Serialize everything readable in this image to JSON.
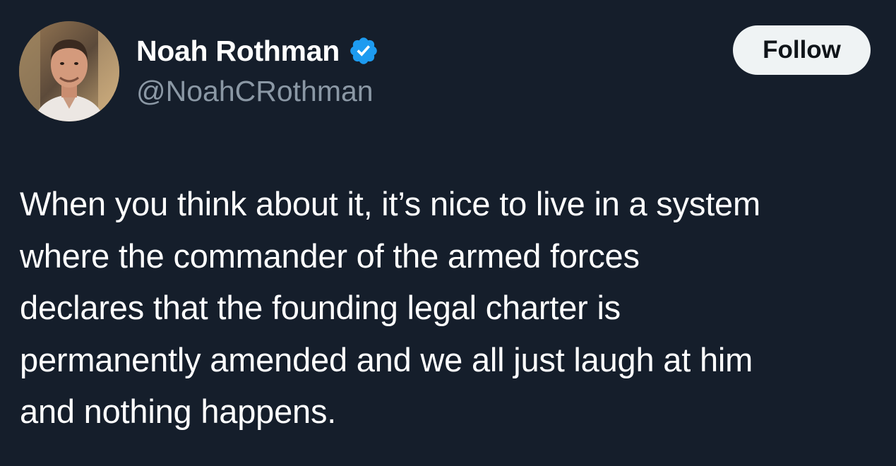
{
  "author": {
    "display_name": "Noah Rothman",
    "handle": "@NoahCRothman",
    "verified": true,
    "avatar_icon": "profile-photo"
  },
  "actions": {
    "follow_label": "Follow"
  },
  "tweet": {
    "lines": [
      "When you think about it, it’s nice to live in a system",
      "where the commander of the armed forces",
      "declares that the founding legal charter is",
      "permanently amended and we all just laugh at him",
      "and nothing happens."
    ]
  },
  "colors": {
    "background": "#151e2b",
    "text_primary": "#ffffff",
    "text_secondary": "#8b98a5",
    "verified_badge": "#1d9bf0",
    "follow_button_bg": "#eff3f4",
    "follow_button_text": "#0f1419"
  }
}
